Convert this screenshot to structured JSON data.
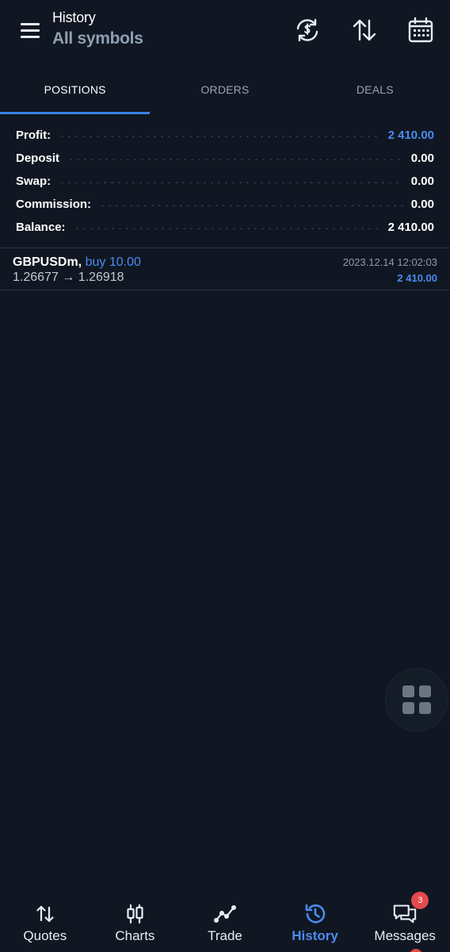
{
  "header": {
    "title": "History",
    "subtitle": "All symbols",
    "icons": [
      "menu-icon",
      "currency-exchange-icon",
      "sort-icon",
      "calendar-icon"
    ]
  },
  "tabs": [
    {
      "label": "POSITIONS",
      "active": true
    },
    {
      "label": "ORDERS",
      "active": false
    },
    {
      "label": "DEALS",
      "active": false
    }
  ],
  "summary": {
    "profit_label": "Profit:",
    "profit_value": "2 410.00",
    "deposit_label": "Deposit",
    "deposit_value": "0.00",
    "swap_label": "Swap:",
    "swap_value": "0.00",
    "commission_label": "Commission:",
    "commission_value": "0.00",
    "balance_label": "Balance:",
    "balance_value": "2 410.00"
  },
  "deals": [
    {
      "symbol": "GBPUSDm,",
      "type": "buy 10.00",
      "prices": "1.26677 → 1.26918",
      "time": "2023.12.14 12:02:03",
      "profit": "2 410.00"
    }
  ],
  "nav": {
    "items": [
      {
        "label": "Quotes",
        "icon": "quotes-icon"
      },
      {
        "label": "Charts",
        "icon": "candlestick-icon"
      },
      {
        "label": "Trade",
        "icon": "trade-icon"
      },
      {
        "label": "History",
        "icon": "history-icon",
        "active": true
      },
      {
        "label": "Messages",
        "icon": "messages-icon",
        "badge": "3"
      }
    ]
  },
  "colors": {
    "background": "#101722",
    "accent": "#4b8bf0",
    "tab_indicator": "#3b82e8",
    "badge": "#e5484d"
  }
}
